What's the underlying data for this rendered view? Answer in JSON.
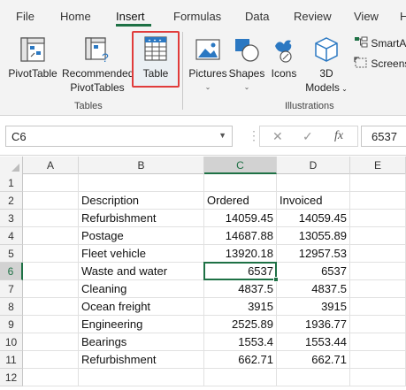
{
  "ribbon_tabs": [
    "File",
    "Home",
    "Insert",
    "Formulas",
    "Data",
    "Review",
    "View",
    "H"
  ],
  "active_tab": "Insert",
  "ribbon": {
    "tables_group": {
      "label": "Tables",
      "pivottable": "PivotTable",
      "recommended_line1": "Recommended",
      "recommended_line2": "PivotTables",
      "table": "Table"
    },
    "illustrations_group": {
      "label": "Illustrations",
      "pictures": "Pictures",
      "shapes": "Shapes",
      "icons": "Icons",
      "models_line1": "3D",
      "models_line2": "Models",
      "smartart": "SmartA",
      "screenshot": "Screens"
    }
  },
  "formula_bar": {
    "name_box": "C6",
    "cancel_symbol": "✕",
    "enter_symbol": "✓",
    "fx_symbol": "fx",
    "value": "6537"
  },
  "columns": [
    "A",
    "B",
    "C",
    "D",
    "E"
  ],
  "selected_column": "C",
  "rows": [
    "1",
    "2",
    "3",
    "4",
    "5",
    "6",
    "7",
    "8",
    "9",
    "10",
    "11",
    "12"
  ],
  "selected_row": "6",
  "table": {
    "headers": [
      "Description",
      "Ordered",
      "Invoiced"
    ],
    "rows": [
      [
        "Refurbishment",
        "14059.45",
        "14059.45"
      ],
      [
        "Postage",
        "14687.88",
        "13055.89"
      ],
      [
        "Fleet vehicle",
        "13920.18",
        "12957.53"
      ],
      [
        "Waste and water",
        "6537",
        "6537"
      ],
      [
        "Cleaning",
        "4837.5",
        "4837.5"
      ],
      [
        "Ocean freight",
        "3915",
        "3915"
      ],
      [
        "Engineering",
        "2525.89",
        "1936.77"
      ],
      [
        "Bearings",
        "1553.4",
        "1553.44"
      ],
      [
        "Refurbishment",
        "662.71",
        "662.71"
      ]
    ]
  },
  "colors": {
    "accent_green": "#1e7145",
    "highlight_red": "#e03c3c"
  }
}
